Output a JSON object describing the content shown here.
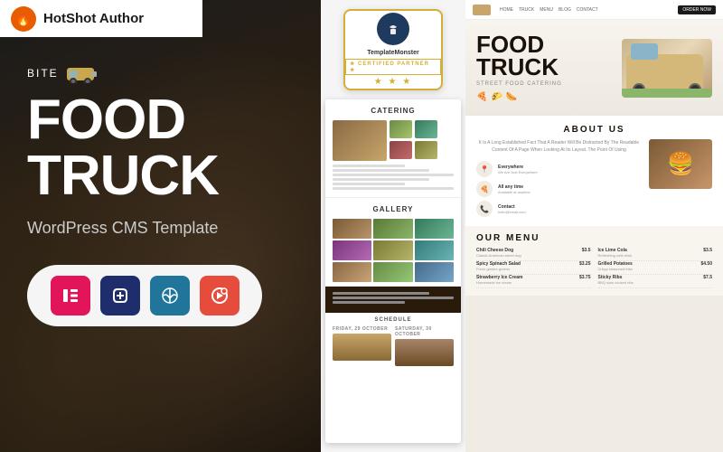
{
  "brand": {
    "name": "HotShot Author",
    "logo_color": "#e85d00"
  },
  "left": {
    "bite_label": "BITE",
    "title_line1": "FOOD",
    "title_line2": "TRUCK",
    "subtitle": "WordPress CMS Template",
    "plugins": [
      {
        "name": "Elementor",
        "abbr": "E",
        "color": "#e2145a"
      },
      {
        "name": "Unlimited Elements",
        "abbr": "UE",
        "color": "#1e2d6b"
      },
      {
        "name": "WordPress",
        "abbr": "WP",
        "color": "#21759b"
      },
      {
        "name": "Revolution Slider",
        "abbr": "R",
        "color": "#e64c3c"
      }
    ]
  },
  "middle": {
    "badge": {
      "title": "TemplateMonster",
      "certified": "★ CERTIFIED PARTNER ★",
      "stars": "★ ★ ★"
    },
    "sections": {
      "catering": "CATERING",
      "gallery": "GALLERY",
      "schedule": "SCHEDULE",
      "schedule_date1": "FRIDAY, 29 OCTOBER",
      "schedule_date2": "SATURDAY, 30 OCTOBER"
    }
  },
  "right": {
    "nav_items": [
      "HOME",
      "TRUCK",
      "MENU",
      "BLOG",
      "CONTACT"
    ],
    "nav_btn": "ORDER NOW",
    "hero_title_line1": "FOOD",
    "hero_title_line2": "TRUCK",
    "about_title": "ABOUT US",
    "about_text": "It Is A Long Established Fact That A Reader Will Be Distracted By The Readable Content Of A Page When Looking At Its Layout. The Point Of Using",
    "features": [
      {
        "icon": "📍",
        "name": "Everywhere",
        "sub": "We Are Just Everywhere"
      },
      {
        "icon": "🍕",
        "name": "All any time",
        "sub": "Available at anytime"
      },
      {
        "icon": "📞",
        "name": "Contact",
        "sub": "hello@email.com"
      }
    ],
    "menu_title": "OUR MENU",
    "menu_items": [
      {
        "name": "Chili Cheese Dog",
        "price": "$3.5",
        "col2name": "Ice Lime Cola",
        "col2price": "$3.5"
      },
      {
        "name": "Spicy Spinach Salad",
        "price": "$3.25",
        "col2name": "Grilled Potatoes",
        "col2price": "$4.50"
      },
      {
        "name": "Strawberry Ice Cream",
        "price": "$3.75",
        "col2name": "Sticky Ribs",
        "col2price": "$7.5"
      }
    ]
  }
}
